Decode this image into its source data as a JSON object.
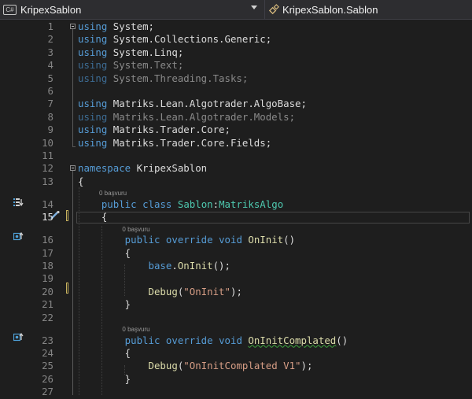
{
  "navbar": {
    "project": "KripexSablon",
    "member": "KripexSablon.Sablon"
  },
  "lines": [
    {
      "n": "1",
      "tokens": [
        {
          "t": "using",
          "c": "kw"
        },
        {
          "t": " System;",
          "c": "ns"
        }
      ]
    },
    {
      "n": "2",
      "tokens": [
        {
          "t": "using",
          "c": "kw"
        },
        {
          "t": " System.Collections.Generic;",
          "c": "ns"
        }
      ]
    },
    {
      "n": "3",
      "tokens": [
        {
          "t": "using",
          "c": "kw"
        },
        {
          "t": " System.Linq;",
          "c": "ns"
        }
      ]
    },
    {
      "n": "4",
      "tokens": [
        {
          "t": "using",
          "c": "dimkw"
        },
        {
          "t": " System.Text;",
          "c": "dim"
        }
      ]
    },
    {
      "n": "5",
      "tokens": [
        {
          "t": "using",
          "c": "dimkw"
        },
        {
          "t": " System.Threading.Tasks;",
          "c": "dim"
        }
      ]
    },
    {
      "n": "6",
      "tokens": []
    },
    {
      "n": "7",
      "tokens": [
        {
          "t": "using",
          "c": "kw"
        },
        {
          "t": " Matriks.Lean.Algotrader.AlgoBase;",
          "c": "ns"
        }
      ]
    },
    {
      "n": "8",
      "tokens": [
        {
          "t": "using",
          "c": "dimkw"
        },
        {
          "t": " Matriks.Lean.Algotrader.Models;",
          "c": "dim"
        }
      ]
    },
    {
      "n": "9",
      "tokens": [
        {
          "t": "using",
          "c": "kw"
        },
        {
          "t": " Matriks.Trader.Core;",
          "c": "ns"
        }
      ]
    },
    {
      "n": "10",
      "tokens": [
        {
          "t": "using",
          "c": "kw"
        },
        {
          "t": " Matriks.Trader.Core.Fields;",
          "c": "ns"
        }
      ]
    },
    {
      "n": "11",
      "tokens": []
    },
    {
      "n": "12",
      "tokens": [
        {
          "t": "namespace",
          "c": "kw"
        },
        {
          "t": " KripexSablon",
          "c": "ns"
        }
      ]
    },
    {
      "n": "13",
      "tokens": [
        {
          "t": "{",
          "c": "ns"
        }
      ]
    },
    {
      "n": "14",
      "lens": "0 başvuru",
      "tokens": [
        {
          "t": "    public",
          "c": "kw"
        },
        {
          "t": " ",
          "c": "ns"
        },
        {
          "t": "class",
          "c": "kw"
        },
        {
          "t": " ",
          "c": "ns"
        },
        {
          "t": "Sablon",
          "c": "type"
        },
        {
          "t": ":",
          "c": "ns"
        },
        {
          "t": "MatriksAlgo",
          "c": "type"
        }
      ]
    },
    {
      "n": "15",
      "current": true,
      "tokens": [
        {
          "t": "    {",
          "c": "ns"
        }
      ]
    },
    {
      "n": "16",
      "lens": "0 başvuru",
      "tokens": [
        {
          "t": "        public",
          "c": "kw"
        },
        {
          "t": " ",
          "c": "ns"
        },
        {
          "t": "override",
          "c": "kw"
        },
        {
          "t": " ",
          "c": "ns"
        },
        {
          "t": "void",
          "c": "kw"
        },
        {
          "t": " ",
          "c": "ns"
        },
        {
          "t": "OnInit",
          "c": "method"
        },
        {
          "t": "()",
          "c": "ns"
        }
      ]
    },
    {
      "n": "17",
      "tokens": [
        {
          "t": "        {",
          "c": "ns"
        }
      ]
    },
    {
      "n": "18",
      "tokens": [
        {
          "t": "            base",
          "c": "kw"
        },
        {
          "t": ".",
          "c": "ns"
        },
        {
          "t": "OnInit",
          "c": "method"
        },
        {
          "t": "();",
          "c": "ns"
        }
      ]
    },
    {
      "n": "19",
      "tokens": []
    },
    {
      "n": "20",
      "tokens": [
        {
          "t": "            Debug",
          "c": "method"
        },
        {
          "t": "(",
          "c": "ns"
        },
        {
          "t": "\"OnInit\"",
          "c": "str"
        },
        {
          "t": ");",
          "c": "ns"
        }
      ]
    },
    {
      "n": "21",
      "tokens": [
        {
          "t": "        }",
          "c": "ns"
        }
      ]
    },
    {
      "n": "22",
      "tokens": []
    },
    {
      "n": "23",
      "lens": "0 başvuru",
      "tokens": [
        {
          "t": "        public",
          "c": "kw"
        },
        {
          "t": " ",
          "c": "ns"
        },
        {
          "t": "override",
          "c": "kw"
        },
        {
          "t": " ",
          "c": "ns"
        },
        {
          "t": "void",
          "c": "kw"
        },
        {
          "t": " ",
          "c": "ns"
        },
        {
          "t": "OnInitComplated",
          "c": "method squiggle"
        },
        {
          "t": "()",
          "c": "ns"
        }
      ]
    },
    {
      "n": "24",
      "tokens": [
        {
          "t": "        {",
          "c": "ns"
        }
      ]
    },
    {
      "n": "25",
      "tokens": [
        {
          "t": "            Debug",
          "c": "method"
        },
        {
          "t": "(",
          "c": "ns"
        },
        {
          "t": "\"OnInitComplated V1\"",
          "c": "str"
        },
        {
          "t": ");",
          "c": "ns"
        }
      ]
    },
    {
      "n": "26",
      "tokens": [
        {
          "t": "        }",
          "c": "ns"
        }
      ]
    },
    {
      "n": "27",
      "tokens": []
    }
  ],
  "colors": {
    "background": "#1e1e1e",
    "keyword": "#569cd6",
    "type": "#4ec9b0",
    "method": "#dcdcaa",
    "string": "#d69d85",
    "line_number": "#858585",
    "change_marker": "#c8b25e"
  },
  "icons": {
    "project": "csharp-project-icon",
    "member": "class-icon",
    "margin_overrides": "override-glyph-icon",
    "margin_implements": "implements-glyph-icon",
    "margin_quick_action": "quick-action-brush-icon"
  }
}
